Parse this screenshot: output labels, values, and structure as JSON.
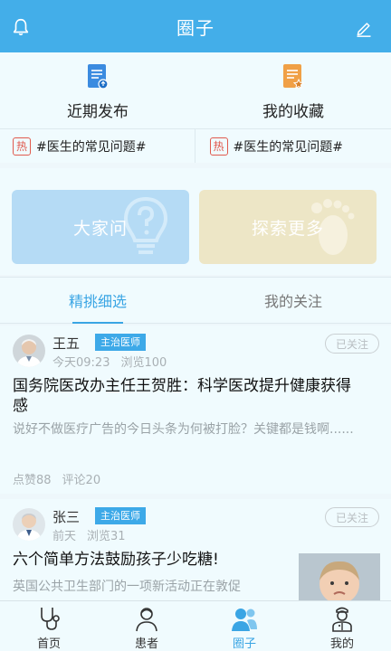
{
  "header": {
    "title": "圈子",
    "left_icon": "bell-icon",
    "right_icon": "pencil-icon",
    "bg_color": "#43aee9"
  },
  "quick_links": [
    {
      "label": "近期发布",
      "icon": "document-blue-icon"
    },
    {
      "label": "我的收藏",
      "icon": "document-star-orange-icon"
    }
  ],
  "hot_topics": [
    {
      "badge": "热",
      "text": "#医生的常见问题#"
    },
    {
      "badge": "热",
      "text": "#医生的常见问题#"
    }
  ],
  "feature_cards": [
    {
      "label": "大家问",
      "icon": "lightbulb-question-icon",
      "color": "#b5dbf5"
    },
    {
      "label": "探索更多",
      "icon": "footprint-icon",
      "color": "#ede6c6"
    }
  ],
  "tabs": [
    {
      "label": "精挑细选",
      "active": true
    },
    {
      "label": "我的关注",
      "active": false
    }
  ],
  "posts": [
    {
      "author": "王五",
      "role": "主治医师",
      "time": "今天09:23",
      "views": "浏览100",
      "follow_label": "已关注",
      "title": "国务院医改办主任王贺胜：科学医改提升健康获得感",
      "excerpt": "说好不做医疗广告的今日头条为何被打脸？关键都是钱啊......",
      "likes": "点赞88",
      "comments": "评论20"
    },
    {
      "author": "张三",
      "role": "主治医师",
      "time": "前天",
      "views": "浏览31",
      "follow_label": "已关注",
      "title": "六个简单方法鼓励孩子少吃糖!",
      "excerpt": "英国公共卫生部门的一项新活动正在敦促"
    }
  ],
  "bottom_nav": [
    {
      "label": "首页",
      "icon": "stethoscope-icon",
      "active": false
    },
    {
      "label": "患者",
      "icon": "patient-icon",
      "active": false
    },
    {
      "label": "圈子",
      "icon": "doctor-group-icon",
      "active": true
    },
    {
      "label": "我的",
      "icon": "doctor-profile-icon",
      "active": false
    }
  ]
}
